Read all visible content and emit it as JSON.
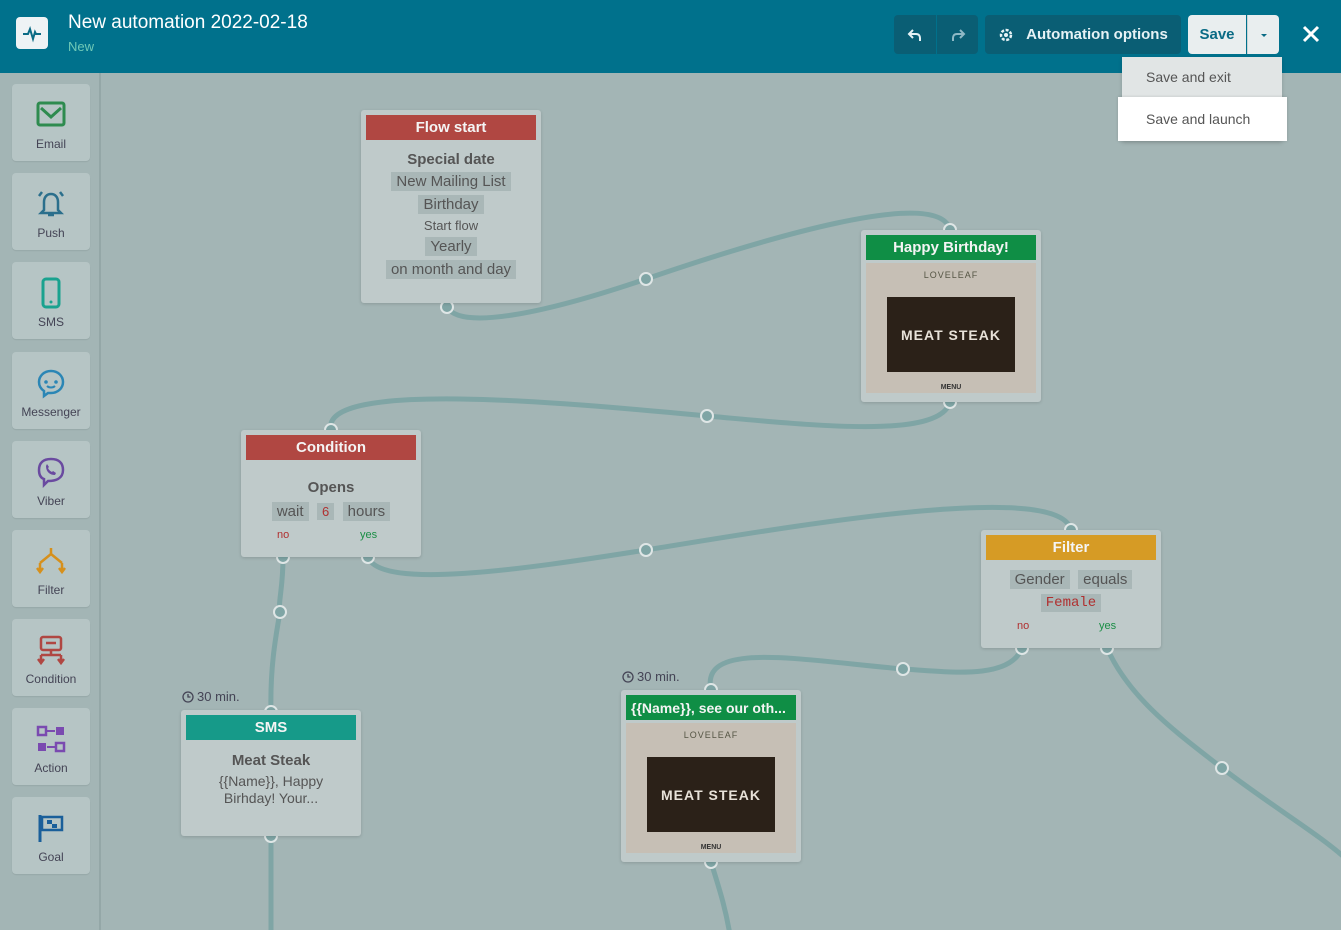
{
  "header": {
    "title": "New automation 2022-02-18",
    "status": "New",
    "options_label": "Automation options",
    "save_label": "Save"
  },
  "save_menu": {
    "items": [
      "Save and exit",
      "Save and launch"
    ]
  },
  "sidebar": {
    "items": [
      {
        "label": "Email",
        "icon": "email-icon",
        "color": "#2e8b4f"
      },
      {
        "label": "Push",
        "icon": "bell-icon",
        "color": "#2b6f8c"
      },
      {
        "label": "SMS",
        "icon": "phone-icon",
        "color": "#1aa28f"
      },
      {
        "label": "Messenger",
        "icon": "messenger-icon",
        "color": "#2b86b5"
      },
      {
        "label": "Viber",
        "icon": "viber-icon",
        "color": "#6a4aa0"
      },
      {
        "label": "Filter",
        "icon": "filter-icon",
        "color": "#d6901c"
      },
      {
        "label": "Condition",
        "icon": "condition-icon",
        "color": "#b04742"
      },
      {
        "label": "Action",
        "icon": "action-icon",
        "color": "#7a4ab0"
      },
      {
        "label": "Goal",
        "icon": "goal-icon",
        "color": "#1a5f9a"
      }
    ]
  },
  "nodes": {
    "flow_start": {
      "header": "Flow start",
      "title": "Special date",
      "list": "New Mailing List",
      "field": "Birthday",
      "start_label": "Start flow",
      "frequency": "Yearly",
      "match": "on month and day"
    },
    "birthday_email": {
      "header": "Happy Birthday!",
      "brand": "LOVELEAF",
      "hero": "MEAT STEAK",
      "menu": "MENU"
    },
    "condition": {
      "header": "Condition",
      "title": "Opens",
      "wait": "wait",
      "value": "6",
      "unit": "hours",
      "no": "no",
      "yes": "yes"
    },
    "filter": {
      "header": "Filter",
      "field": "Gender",
      "operator": "equals",
      "value": "Female",
      "no": "no",
      "yes": "yes"
    },
    "sms": {
      "delay": "30 min.",
      "header": "SMS",
      "title": "Meat Steak",
      "text": "{{Name}}, Happy Birhday! Your..."
    },
    "email2": {
      "delay": "30 min.",
      "header": "{{Name}}, see our oth...",
      "brand": "LOVELEAF",
      "hero": "MEAT STEAK",
      "menu": "MENU"
    }
  },
  "colors": {
    "header_bg": "#00718c",
    "canvas_bg": "#a3b5b5",
    "connector": "#7fa5a5",
    "red_header": "#b04742",
    "green_header": "#0f8e45",
    "orange_header": "#d69b25",
    "teal_header": "#169a89"
  }
}
